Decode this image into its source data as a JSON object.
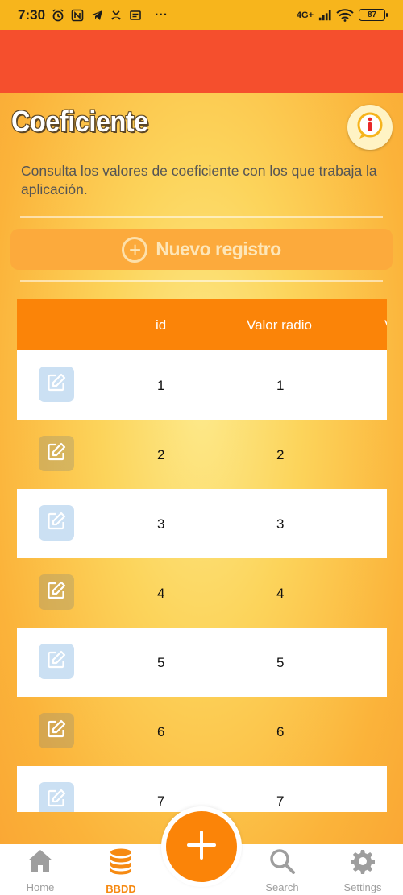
{
  "status_bar": {
    "time": "7:30",
    "network": "4G+",
    "battery": "87",
    "more": "···"
  },
  "page": {
    "title": "Coeficiente",
    "description": "Consulta los valores de coeficiente con los que trabaja la aplicación.",
    "new_record_label": "Nuevo registro"
  },
  "table": {
    "columns": [
      "",
      "id",
      "Valor radio",
      "V"
    ],
    "rows": [
      {
        "id": "1",
        "valor_radio": "1"
      },
      {
        "id": "2",
        "valor_radio": "2"
      },
      {
        "id": "3",
        "valor_radio": "3"
      },
      {
        "id": "4",
        "valor_radio": "4"
      },
      {
        "id": "5",
        "valor_radio": "5"
      },
      {
        "id": "6",
        "valor_radio": "6"
      },
      {
        "id": "7",
        "valor_radio": "7"
      }
    ]
  },
  "bottom_nav": {
    "items": [
      {
        "label": "Home",
        "icon": "home-icon"
      },
      {
        "label": "BBDD",
        "icon": "database-icon",
        "active": true
      },
      {
        "label": "Search",
        "icon": "search-icon"
      },
      {
        "label": "Settings",
        "icon": "gear-icon"
      }
    ]
  },
  "colors": {
    "status_bar": "#f7b51c",
    "app_bar": "#f54f2d",
    "header": "#fb8408",
    "accent": "#f68a12"
  }
}
